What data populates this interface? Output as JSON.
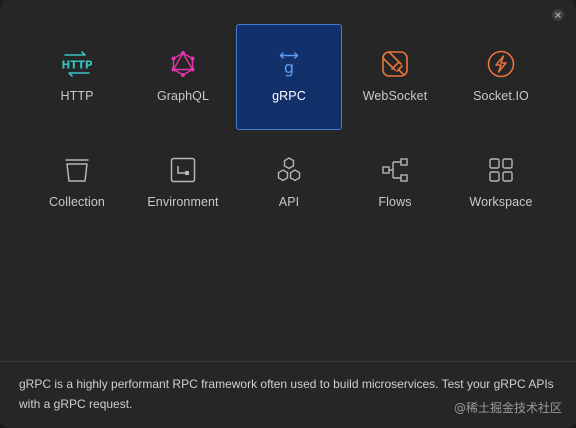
{
  "dialog": {
    "close_icon": "close-icon"
  },
  "request_types": [
    {
      "label": "HTTP",
      "icon": "http-icon",
      "color": "#35c2bd"
    },
    {
      "label": "GraphQL",
      "icon": "graphql-icon",
      "color": "#e535ab"
    },
    {
      "label": "gRPC",
      "icon": "grpc-icon",
      "color": "#5b9cf4",
      "selected": true
    },
    {
      "label": "WebSocket",
      "icon": "websocket-icon",
      "color": "#e8743b"
    },
    {
      "label": "Socket.IO",
      "icon": "socketio-icon",
      "color": "#e8743b"
    }
  ],
  "resource_types": [
    {
      "label": "Collection",
      "icon": "collection-icon"
    },
    {
      "label": "Environment",
      "icon": "environment-icon"
    },
    {
      "label": "API",
      "icon": "api-icon"
    },
    {
      "label": "Flows",
      "icon": "flows-icon"
    },
    {
      "label": "Workspace",
      "icon": "workspace-icon"
    }
  ],
  "description": "gRPC is a highly performant RPC framework often used to build microservices. Test your gRPC APIs with a gRPC request.",
  "watermark": "@稀土掘金技术社区",
  "colors": {
    "selected_bg": "#12316b",
    "selected_border": "#4a78d6",
    "neutral_icon": "#b5b5b5"
  }
}
